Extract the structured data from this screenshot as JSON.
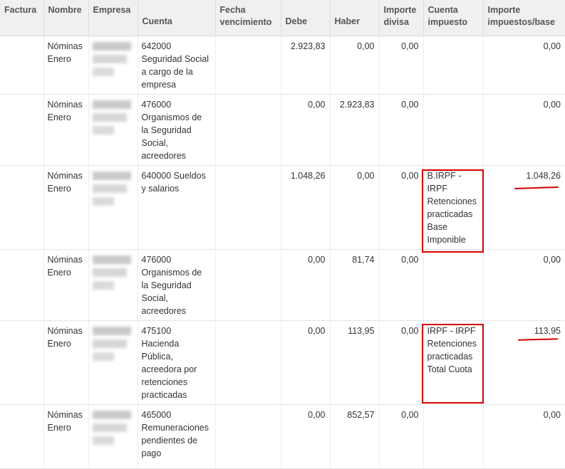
{
  "headers": {
    "factura": "Factura",
    "nombre": "Nombre",
    "empresa": "Empresa",
    "cuenta": "Cuenta",
    "fecha_vencimiento": "Fecha vencimiento",
    "debe": "Debe",
    "haber": "Haber",
    "importe_divisa": "Importe divisa",
    "cuenta_impuesto": "Cuenta impuesto",
    "importe_impuestos_base": "Importe impuestos/base"
  },
  "rows": [
    {
      "factura": "",
      "nombre": "Nóminas Enero",
      "cuenta": "642000 Seguridad Social a cargo de la empresa",
      "fecha_vencimiento": "",
      "debe": "2.923,83",
      "haber": "0,00",
      "importe_divisa": "0,00",
      "cuenta_impuesto": "",
      "importe_impuestos_base": "0,00"
    },
    {
      "factura": "",
      "nombre": "Nóminas Enero",
      "cuenta": "476000 Organismos de la Seguridad Social, acreedores",
      "fecha_vencimiento": "",
      "debe": "0,00",
      "haber": "2.923,83",
      "importe_divisa": "0,00",
      "cuenta_impuesto": "",
      "importe_impuestos_base": "0,00"
    },
    {
      "factura": "",
      "nombre": "Nóminas Enero",
      "cuenta": "640000 Sueldos y salarios",
      "fecha_vencimiento": "",
      "debe": "1.048,26",
      "haber": "0,00",
      "importe_divisa": "0,00",
      "cuenta_impuesto": "B.IRPF - IRPF Retenciones practicadas Base Imponible",
      "importe_impuestos_base": "1.048,26"
    },
    {
      "factura": "",
      "nombre": "Nóminas Enero",
      "cuenta": "476000 Organismos de la Seguridad Social, acreedores",
      "fecha_vencimiento": "",
      "debe": "0,00",
      "haber": "81,74",
      "importe_divisa": "0,00",
      "cuenta_impuesto": "",
      "importe_impuestos_base": "0,00"
    },
    {
      "factura": "",
      "nombre": "Nóminas Enero",
      "cuenta": "475100 Hacienda Pública, acreedora por retenciones practicadas",
      "fecha_vencimiento": "",
      "debe": "0,00",
      "haber": "113,95",
      "importe_divisa": "0,00",
      "cuenta_impuesto": "IRPF - IRPF Retenciones practicadas Total Cuota",
      "importe_impuestos_base": "113,95"
    },
    {
      "factura": "",
      "nombre": "Nóminas Enero",
      "cuenta": "465000 Remuneraciones pendientes de pago",
      "fecha_vencimiento": "",
      "debe": "0,00",
      "haber": "852,57",
      "importe_divisa": "0,00",
      "cuenta_impuesto": "",
      "importe_impuestos_base": "0,00"
    }
  ],
  "annotation_color": "#d40000"
}
